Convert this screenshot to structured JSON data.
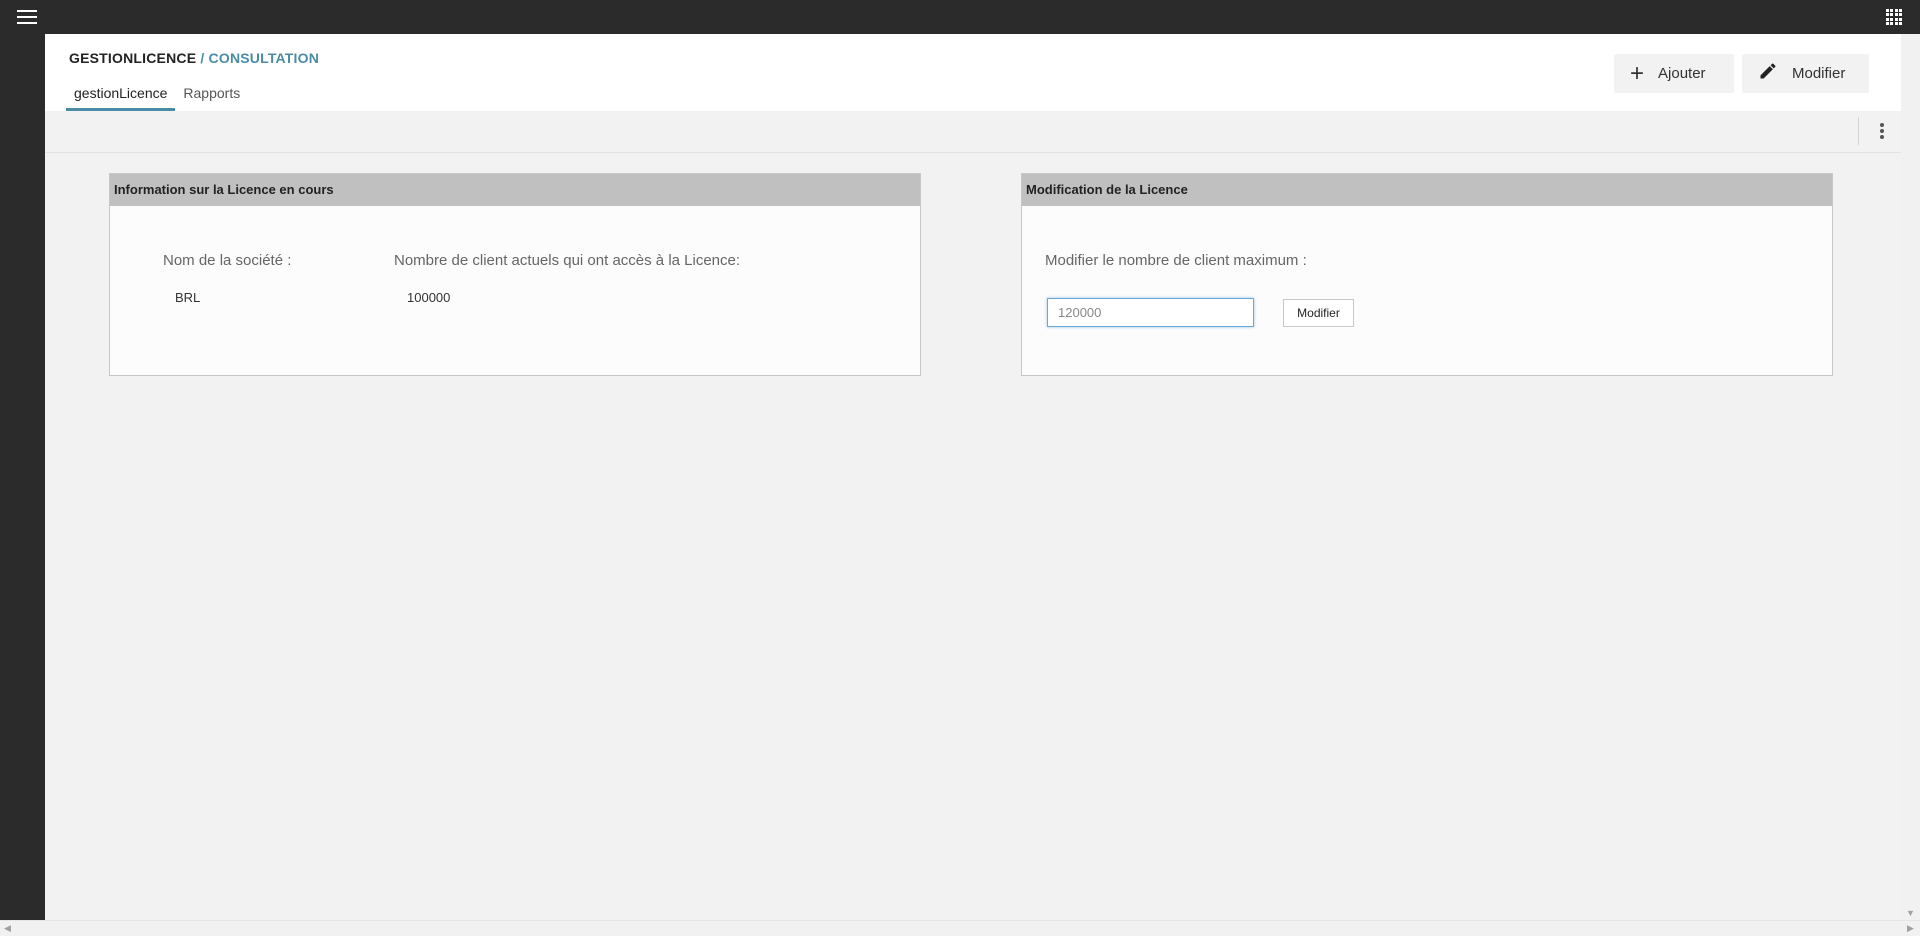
{
  "header": {
    "breadcrumb_root": "GESTIONLICENCE",
    "breadcrumb_sep": " / ",
    "breadcrumb_current": "CONSULTATION",
    "tabs": [
      {
        "label": "gestionLicence",
        "active": true
      },
      {
        "label": "Rapports",
        "active": false
      }
    ],
    "add_label": "Ajouter",
    "edit_label": "Modifier"
  },
  "icons": {
    "menu": "hamburger-menu-icon",
    "apps": "apps-grid-icon",
    "add": "plus-icon",
    "edit": "pencil-icon",
    "more": "more-vertical-icon"
  },
  "panel_info": {
    "title": "Information sur la Licence en cours",
    "company_label": "Nom de la société :",
    "company_value": "BRL",
    "clients_label": "Nombre de client actuels qui ont accès à la Licence:",
    "clients_value": "100000"
  },
  "panel_edit": {
    "title": "Modification de la Licence",
    "max_label": "Modifier le nombre de client maximum :",
    "max_value": "120000",
    "submit_label": "Modifier"
  },
  "colors": {
    "accent": "#4a8ca6",
    "topbar": "#2b2b2b",
    "panel_header": "#c0c0c0",
    "background": "#f2f2f2"
  }
}
